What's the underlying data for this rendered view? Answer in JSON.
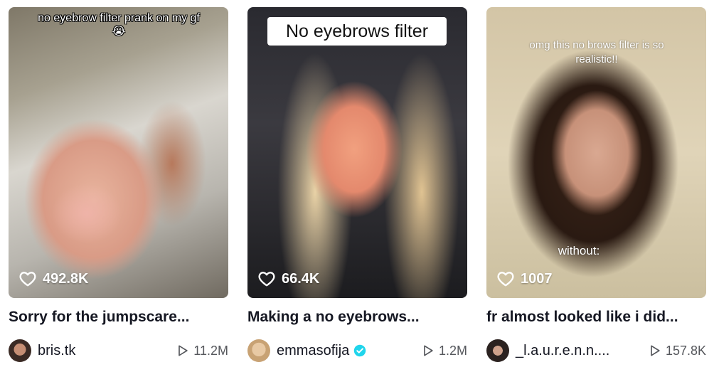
{
  "cards": [
    {
      "overlay_caption": "no eyebrow filter prank on my gf😭",
      "likes": "492.8K",
      "title": "Sorry for the jumpscare...",
      "username": "bris.tk",
      "verified": false,
      "views": "11.2M"
    },
    {
      "overlay_caption": "No eyebrows filter",
      "likes": "66.4K",
      "title": "Making a no eyebrows...",
      "username": "emmasofija",
      "verified": true,
      "views": "1.2M"
    },
    {
      "overlay_caption": "omg this no brows filter is so realistic!!",
      "overlay_caption_2": "without:",
      "likes": "1007",
      "title": "fr almost looked like i did...",
      "username": "_l.a.u.r.e.n.n....",
      "verified": false,
      "views": "157.8K"
    }
  ],
  "icons": {
    "likes": "heart-outline-icon",
    "views": "play-outline-icon",
    "verified": "verified-badge-icon"
  },
  "colors": {
    "verified": "#20d5ec",
    "text": "#161823",
    "muted": "#55575c"
  }
}
